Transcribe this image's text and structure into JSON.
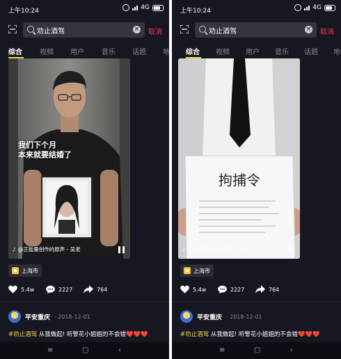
{
  "panels": [
    {
      "status": {
        "time": "上午10:24",
        "network": "4G"
      },
      "search": {
        "query": "劝止酒驾",
        "cancel": "取消"
      },
      "tabs": [
        "综合",
        "视频",
        "用户",
        "音乐",
        "话题",
        "地"
      ],
      "video": {
        "caption_line1": "我们下个月",
        "caption_line2": "本来就要结婚了",
        "music": "@正能量创作的原声 - 吴老"
      },
      "location": "上海市",
      "stats": {
        "likes": "5.4w",
        "comments": "2227",
        "shares": "764"
      },
      "author": {
        "name": "平安重庆",
        "date": "· 2018-12-01"
      },
      "description": {
        "tag": "#劝止酒驾",
        "text": " 从我做起! 听警花小姐姐的不会错",
        "hearts": "❤️❤️❤️"
      }
    },
    {
      "status": {
        "time": "上午10:24",
        "network": "4G"
      },
      "search": {
        "query": "劝止酒驾",
        "cancel": "取消"
      },
      "tabs": [
        "综合",
        "视频",
        "用户",
        "音乐",
        "话题",
        "地"
      ],
      "video": {
        "paper_text": "拘捕令",
        "music": "@正能量创作的原声 - 吴老"
      },
      "location": "上海市",
      "stats": {
        "likes": "5.4w",
        "comments": "2227",
        "shares": "764"
      },
      "author": {
        "name": "平安重庆",
        "date": "· 2018-12-01"
      },
      "description": {
        "tag": "#劝止酒驾",
        "text": " 从我做起! 听警花小姐姐的不会错",
        "hearts": "❤️❤️❤️"
      }
    }
  ],
  "navbar": {
    "menu": "≡",
    "home": "▢",
    "back": "‹"
  },
  "colors": {
    "background": "#171722",
    "accent_red": "#f23a55",
    "accent_yellow": "#f6d64a"
  }
}
